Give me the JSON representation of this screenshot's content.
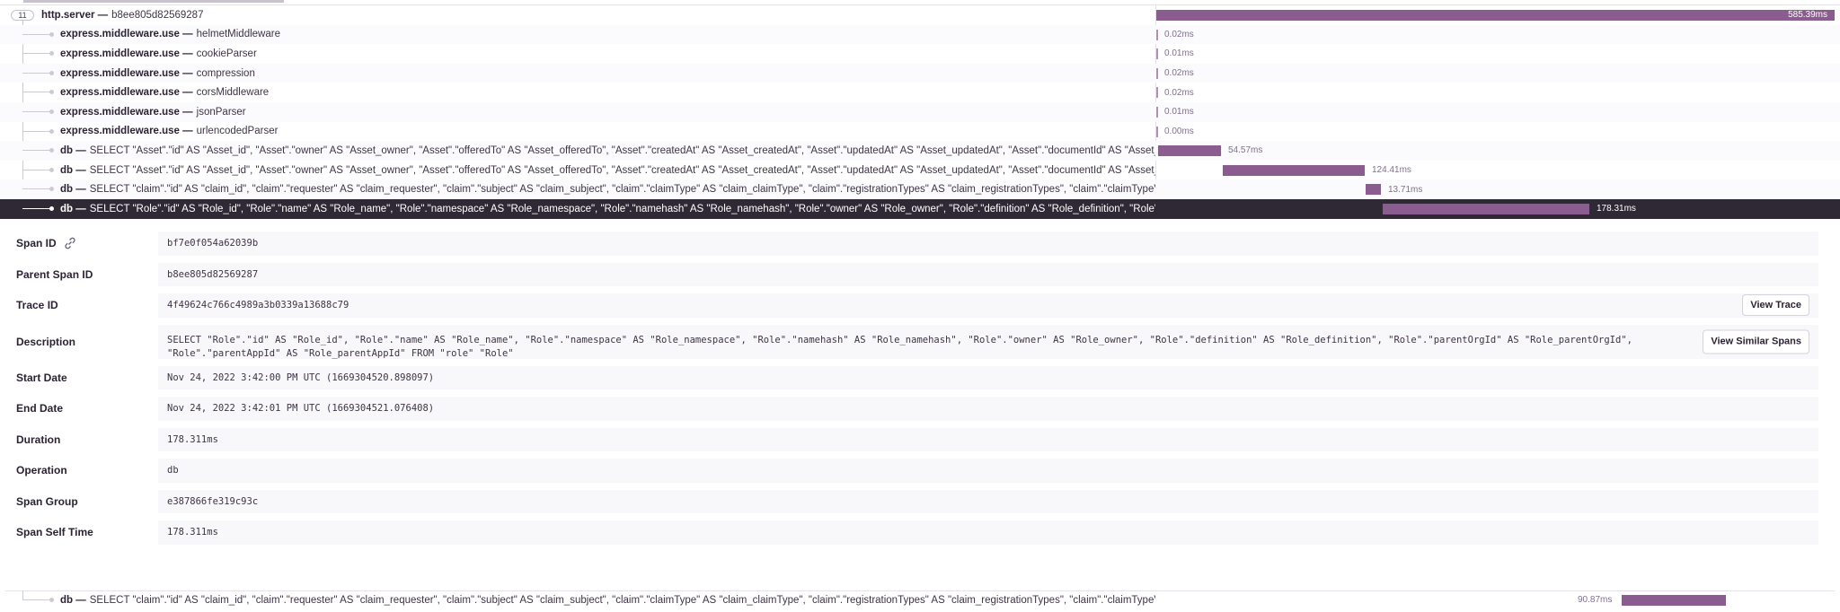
{
  "root_span": {
    "toggle_count": "11",
    "op": "http.server —",
    "desc": "b8ee805d82569287",
    "duration": "585.39ms"
  },
  "spans": [
    {
      "op": "express.middleware.use —",
      "desc": "helmetMiddleware",
      "duration": "0.02ms"
    },
    {
      "op": "express.middleware.use —",
      "desc": "cookieParser",
      "duration": "0.01ms"
    },
    {
      "op": "express.middleware.use —",
      "desc": "compression",
      "duration": "0.02ms"
    },
    {
      "op": "express.middleware.use —",
      "desc": "corsMiddleware",
      "duration": "0.02ms"
    },
    {
      "op": "express.middleware.use —",
      "desc": "jsonParser",
      "duration": "0.01ms"
    },
    {
      "op": "express.middleware.use —",
      "desc": "urlencodedParser",
      "duration": "0.00ms"
    },
    {
      "op": "db —",
      "desc": "SELECT \"Asset\".\"id\" AS \"Asset_id\", \"Asset\".\"owner\" AS \"Asset_owner\", \"Asset\".\"offeredTo\" AS \"Asset_offeredTo\", \"Asset\".\"createdAt\" AS \"Asset_createdAt\", \"Asset\".\"updatedAt\" AS \"Asset_updatedAt\", \"Asset\".\"documentId\" AS \"Asset_documentId\"",
      "duration": "54.57ms"
    },
    {
      "op": "db —",
      "desc": "SELECT \"Asset\".\"id\" AS \"Asset_id\", \"Asset\".\"owner\" AS \"Asset_owner\", \"Asset\".\"offeredTo\" AS \"Asset_offeredTo\", \"Asset\".\"createdAt\" AS \"Asset_createdAt\", \"Asset\".\"updatedAt\" AS \"Asset_updatedAt\", \"Asset\".\"documentId\" AS \"Asset_documentId\"",
      "duration": "124.41ms"
    },
    {
      "op": "db —",
      "desc": "SELECT \"claim\".\"id\" AS \"claim_id\", \"claim\".\"requester\" AS \"claim_requester\", \"claim\".\"subject\" AS \"claim_subject\", \"claim\".\"claimType\" AS \"claim_claimType\", \"claim\".\"registrationTypes\" AS \"claim_registrationTypes\", \"claim\".\"claimTypeVersion\" AS",
      "duration": "13.71ms"
    },
    {
      "op": "db —",
      "desc": "SELECT \"Role\".\"id\" AS \"Role_id\", \"Role\".\"name\" AS \"Role_name\", \"Role\".\"namespace\" AS \"Role_namespace\", \"Role\".\"namehash\" AS \"Role_namehash\", \"Role\".\"owner\" AS \"Role_owner\", \"Role\".\"definition\" AS \"Role_definition\", \"Role\".\"parentOrgId\" AS",
      "duration": "178.31ms"
    }
  ],
  "details": {
    "span_id": {
      "label": "Span ID",
      "value": "bf7e0f054a62039b"
    },
    "parent_span_id": {
      "label": "Parent Span ID",
      "value": "b8ee805d82569287"
    },
    "trace_id": {
      "label": "Trace ID",
      "value": "4f49624c766c4989a3b0339a13688c79",
      "button": "View Trace"
    },
    "description": {
      "label": "Description",
      "value": "SELECT \"Role\".\"id\" AS \"Role_id\", \"Role\".\"name\" AS \"Role_name\", \"Role\".\"namespace\" AS \"Role_namespace\", \"Role\".\"namehash\" AS \"Role_namehash\", \"Role\".\"owner\" AS \"Role_owner\", \"Role\".\"definition\" AS \"Role_definition\", \"Role\".\"parentOrgId\" AS \"Role_parentOrgId\", \"Role\".\"parentAppId\" AS \"Role_parentAppId\" FROM \"role\" \"Role\"",
      "button": "View Similar Spans"
    },
    "start_date": {
      "label": "Start Date",
      "value": "Nov 24, 2022 3:42:00 PM UTC (1669304520.898097)"
    },
    "end_date": {
      "label": "End Date",
      "value": "Nov 24, 2022 3:42:01 PM UTC (1669304521.076408)"
    },
    "duration": {
      "label": "Duration",
      "value": "178.311ms"
    },
    "operation": {
      "label": "Operation",
      "value": "db"
    },
    "span_group": {
      "label": "Span Group",
      "value": "e387866fe319c93c"
    },
    "span_self_time": {
      "label": "Span Self Time",
      "value": "178.311ms"
    }
  },
  "bottom_span": {
    "op": "db —",
    "desc": "SELECT \"claim\".\"id\" AS \"claim_id\", \"claim\".\"requester\" AS \"claim_requester\", \"claim\".\"subject\" AS \"claim_subject\", \"claim\".\"claimType\" AS \"claim_claimType\", \"claim\".\"registrationTypes\" AS \"claim_registrationTypes\", \"claim\".\"claimTypeVersion\" AS",
    "duration": "90.87ms"
  },
  "colors": {
    "bar": "#8b5c8f",
    "selected_row": "#2f2936"
  }
}
